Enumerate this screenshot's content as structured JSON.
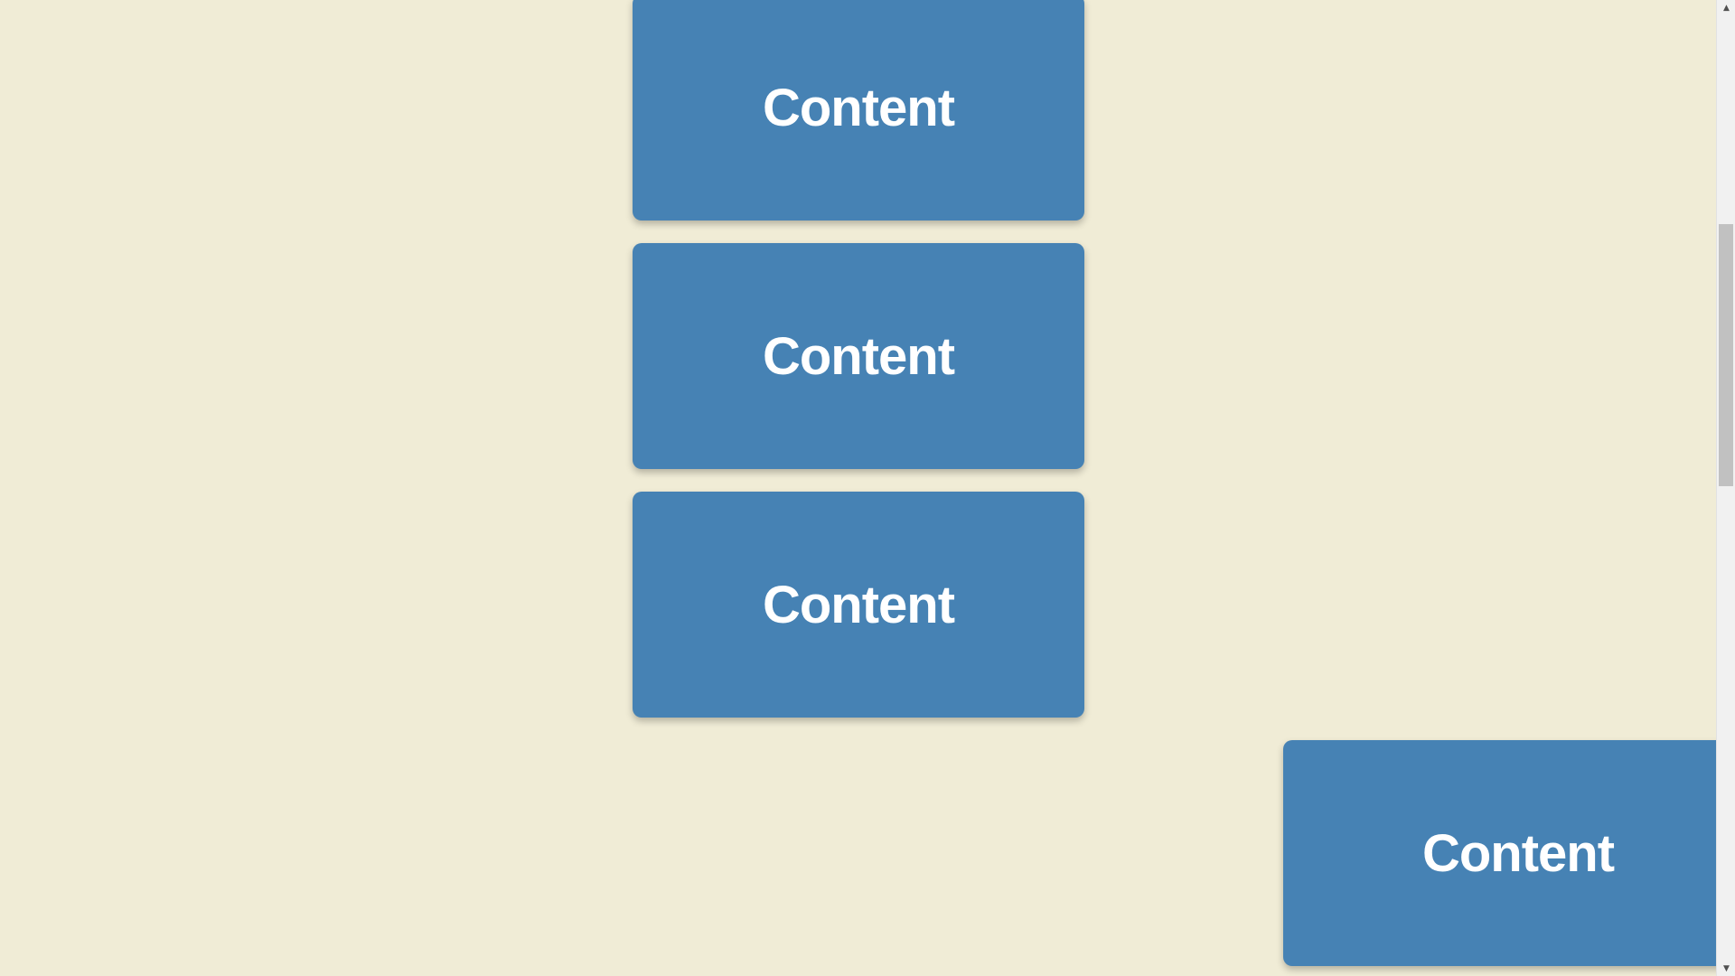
{
  "page": {
    "background_color": "#f0ecd6",
    "card_color": "#4682b4",
    "card_text_color": "#ffffff"
  },
  "cards": [
    {
      "label": "Content"
    },
    {
      "label": "Content"
    },
    {
      "label": "Content"
    },
    {
      "label": "Content"
    }
  ],
  "scrollbar": {
    "up_icon": "triangle-up-icon",
    "down_icon": "triangle-down-icon"
  }
}
